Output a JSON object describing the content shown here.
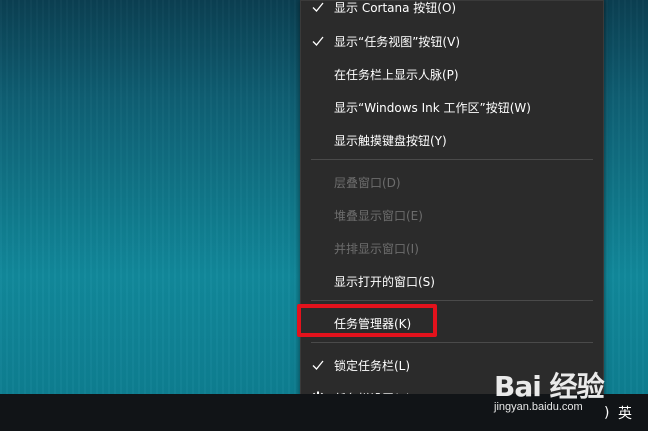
{
  "context_menu": {
    "items": [
      {
        "label": "显示 Cortana 按钮(O)",
        "checked": true,
        "enabled": true
      },
      {
        "label": "显示“任务视图”按钮(V)",
        "checked": true,
        "enabled": true
      },
      {
        "label": "在任务栏上显示人脉(P)",
        "checked": false,
        "enabled": true
      },
      {
        "label": "显示“Windows Ink 工作区”按钮(W)",
        "checked": false,
        "enabled": true
      },
      {
        "label": "显示触摸键盘按钮(Y)",
        "checked": false,
        "enabled": true
      },
      {
        "label": "层叠窗口(D)",
        "checked": false,
        "enabled": false
      },
      {
        "label": "堆叠显示窗口(E)",
        "checked": false,
        "enabled": false
      },
      {
        "label": "并排显示窗口(I)",
        "checked": false,
        "enabled": false
      },
      {
        "label": "显示打开的窗口(S)",
        "checked": false,
        "enabled": true
      },
      {
        "label": "任务管理器(K)",
        "checked": false,
        "enabled": true,
        "highlighted": true
      },
      {
        "label": "锁定任务栏(L)",
        "checked": true,
        "enabled": true
      },
      {
        "label": "任务栏设置(T)",
        "checked": false,
        "enabled": true,
        "icon": "gear-icon"
      }
    ]
  },
  "taskbar": {
    "ime_label": "英",
    "volume_glyph": ")"
  },
  "watermark": {
    "logo_text": "Bai 经验",
    "url": "jingyan.baidu.com"
  },
  "colors": {
    "menu_bg": "#2b2b2b",
    "highlight_border": "#e3121c",
    "disabled_text": "#6d6d6d"
  }
}
